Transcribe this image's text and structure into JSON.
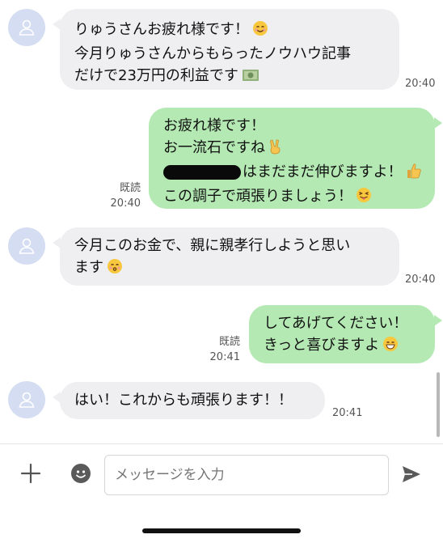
{
  "messages": [
    {
      "side": "incoming",
      "lines": [
        "りゅうさんお疲れ様です！",
        "今月りゅうさんからもらったノウハウ記事",
        "だけで23万円の利益です"
      ],
      "emojis": [
        "smiling-face-emoji",
        "money-emoji"
      ],
      "time": "20:40"
    },
    {
      "side": "outgoing",
      "lines": [
        "お疲れ様です！",
        "お一流石ですね",
        "はまだまだ伸びますよ！",
        "この調子で頑張りましょう！"
      ],
      "emojis": [
        "victory-hand-emoji",
        "thumbs-up-emoji",
        "tongue-wink-emoji"
      ],
      "read": "既読",
      "time": "20:40"
    },
    {
      "side": "incoming",
      "lines": [
        "今月このお金で、親に親孝行しようと思い",
        "ます"
      ],
      "emojis": [
        "kissing-face-emoji"
      ],
      "time": "20:40"
    },
    {
      "side": "outgoing",
      "lines": [
        "してあげてください！",
        "きっと喜びますよ"
      ],
      "emojis": [
        "grinning-face-emoji"
      ],
      "read": "既読",
      "time": "20:41"
    },
    {
      "side": "incoming",
      "lines": [
        "はい！これからも頑張ります！！"
      ],
      "time": "20:41"
    }
  ],
  "input": {
    "placeholder": "メッセージを入力"
  },
  "icons": {
    "add": "plus-icon",
    "sticker": "sticker-icon",
    "send": "send-icon",
    "avatar": "default-avatar-icon"
  },
  "colors": {
    "incoming_bubble": "#efeff2",
    "outgoing_bubble": "#b4e9b3",
    "avatar_bg": "#d5ddf2",
    "icon_gray": "#555555"
  }
}
